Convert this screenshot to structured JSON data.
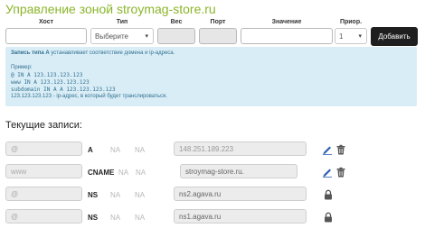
{
  "title": "Управление зоной stroymag-store.ru",
  "form": {
    "labels": {
      "host": "Хост",
      "type": "Тип",
      "weight": "Вес",
      "port": "Порт",
      "value": "Значение",
      "priority": "Приор."
    },
    "type_select": "Выберите",
    "priority_select": "1",
    "add_button": "Добавить"
  },
  "info": {
    "heading": "Запись типа A",
    "heading_rest": " устанавливает соответствие домена и ip-адреса.",
    "example_label": "Пример:",
    "examples": [
      "@ IN A 123.123.123.123",
      "www IN A 123.123.123.123",
      "subdomain IN A A 123.123.123.123"
    ],
    "note": "123.123.123.123 - ip-адрес, в который будет транслироваться."
  },
  "records_title": "Текущие записи:",
  "records": [
    {
      "host": "@",
      "type": "A",
      "weight": "NA",
      "port": "NA",
      "value": "148.251.189.223",
      "editable": true
    },
    {
      "host": "www",
      "type": "CNAME",
      "weight": "NA",
      "port": "NA",
      "value": "stroymag-store.ru.",
      "editable": true
    },
    {
      "host": "@",
      "type": "NS",
      "weight": "NA",
      "port": "NA",
      "value": "ns2.agava.ru",
      "editable": false
    },
    {
      "host": "@",
      "type": "NS",
      "weight": "NA",
      "port": "NA",
      "value": "ns1.agava.ru",
      "editable": false
    }
  ],
  "colors": {
    "title": "#8ab52a",
    "info_bg": "#d9edf7",
    "info_text": "#31708f",
    "edit_icon": "#2a5db0"
  }
}
